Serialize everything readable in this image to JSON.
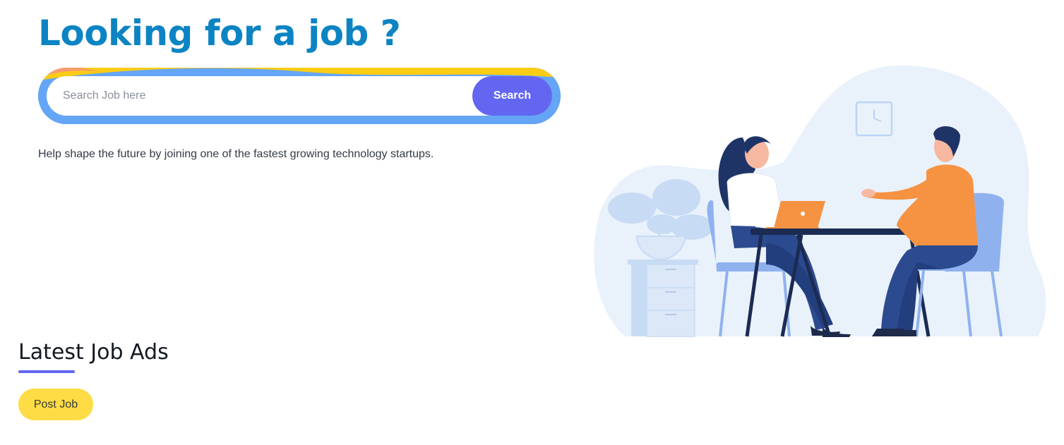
{
  "hero": {
    "title": "Looking for a job ?",
    "tagline": "Help shape the future by joining one of the fastest growing technology startups."
  },
  "search": {
    "placeholder": "Search Job here",
    "value": "",
    "button_label": "Search"
  },
  "jobs_section": {
    "title": "Latest Job Ads",
    "post_button_label": "Post Job"
  },
  "colors": {
    "title_blue": "#0c84c3",
    "accent_indigo": "#6366f1",
    "search_border_blue": "#64a5f6",
    "wave_yellow": "#facc15",
    "post_button_yellow": "#fddc45"
  },
  "illustration": {
    "subject": "job-interview-illustration"
  }
}
